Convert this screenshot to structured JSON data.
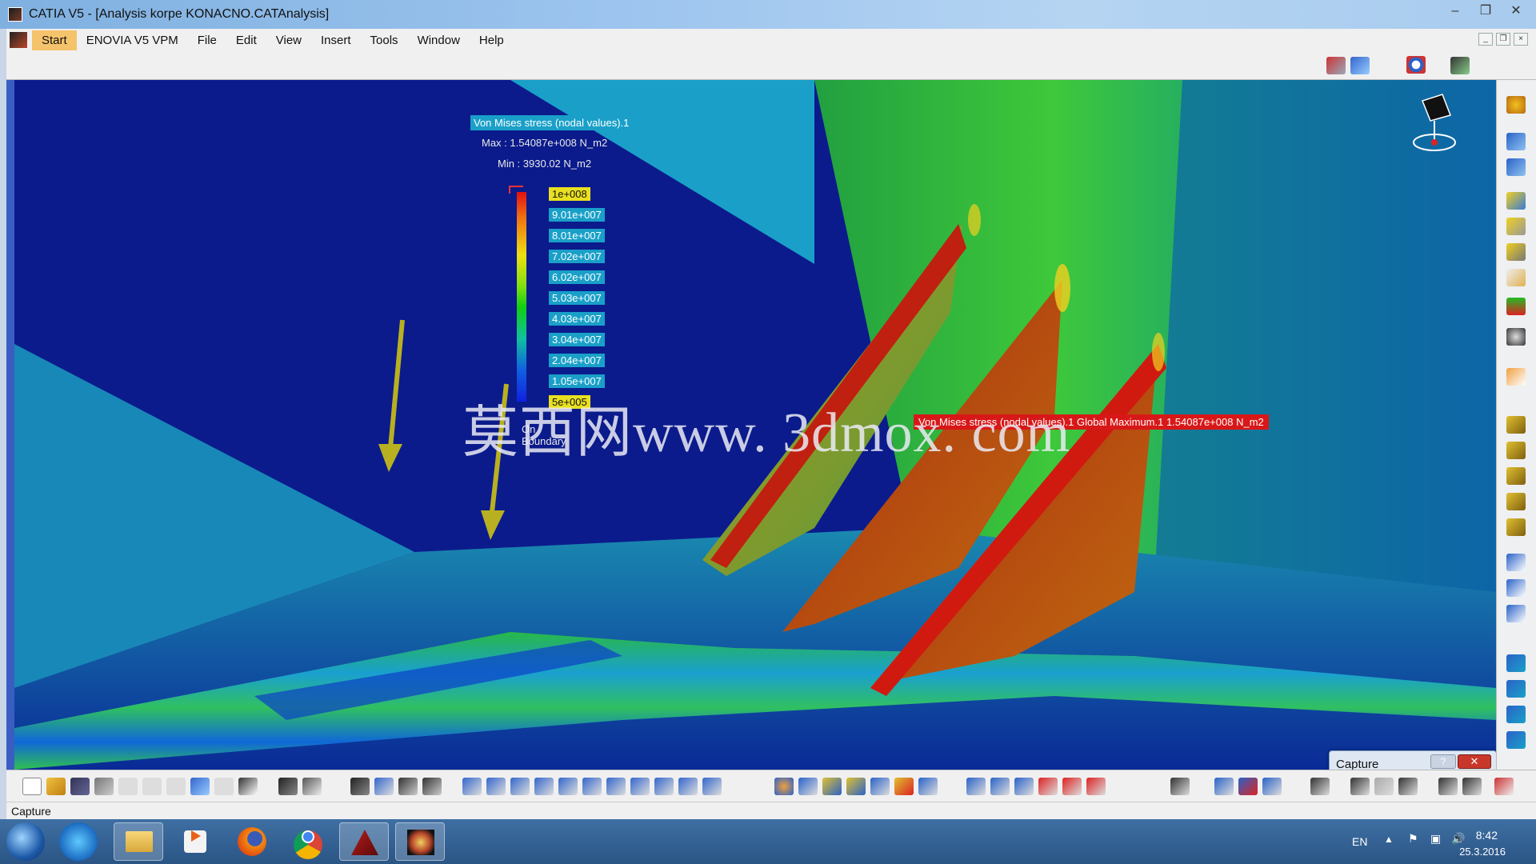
{
  "window": {
    "title": "CATIA V5 - [Analysis korpe KONACNO.CATAnalysis]",
    "minimize": "–",
    "maximize": "❐",
    "close": "✕"
  },
  "menu": {
    "items": [
      "Start",
      "ENOVIA V5 VPM",
      "File",
      "Edit",
      "View",
      "Insert",
      "Tools",
      "Window",
      "Help"
    ]
  },
  "legend": {
    "title": "Von Mises stress (nodal values).1",
    "max": "Max : 1.54087e+008 N_m2",
    "min": "Min : 3930.02 N_m2",
    "values": [
      "1e+008",
      "9.01e+007",
      "8.01e+007",
      "7.02e+007",
      "6.02e+007",
      "5.03e+007",
      "4.03e+007",
      "3.04e+007",
      "2.04e+007",
      "1.05e+007",
      "5e+005"
    ],
    "on_boundary": "On Boundary"
  },
  "max_annotation": "Von Mises stress (nodal values).1  Global Maximum.1  1.54087e+008 N_m2",
  "watermark": "莫西网www. 3dmox. com",
  "capture_dialog": {
    "title": "Capture",
    "help": "?",
    "close": "✕"
  },
  "status_bar": "Capture",
  "taskbar": {
    "language": "EN",
    "time": "8:42",
    "date": "25.3.2016"
  },
  "colors": {
    "viewport_background": "#0b1b8c",
    "accent_start": "#f5c36b",
    "legend_tag": "#1aa0c8",
    "legend_highlight": "#e8e020",
    "max_label": "#d81818"
  }
}
